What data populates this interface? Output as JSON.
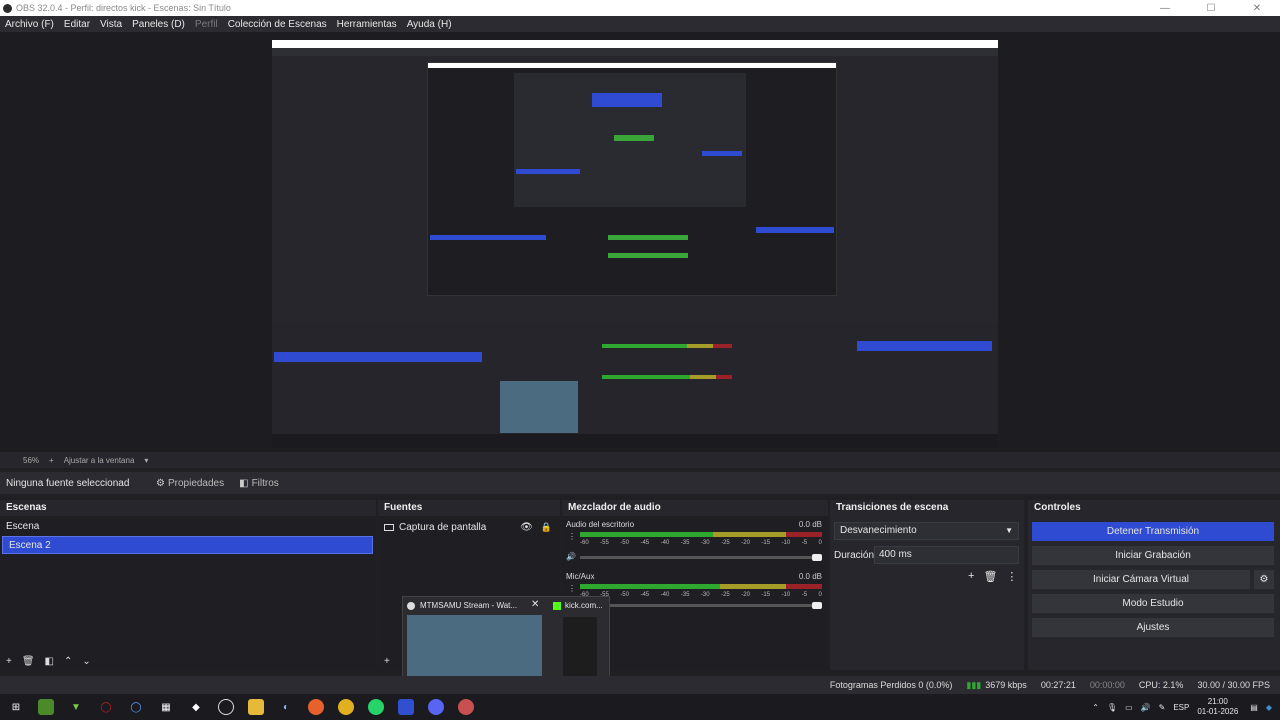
{
  "window": {
    "title": "OBS 32.0.4 - Perfil: directos kick - Escenas: Sin Título"
  },
  "menu": [
    "Archivo (F)",
    "Editar",
    "Vista",
    "Paneles (D)",
    "Perfil",
    "Colección de Escenas",
    "Herramientas",
    "Ayuda (H)"
  ],
  "zoom": {
    "value": "56%",
    "fit_label": "Ajustar a la ventana"
  },
  "context": {
    "no_source": "Ninguna fuente seleccionad",
    "properties": "Propiedades",
    "filters": "Filtros"
  },
  "scenes": {
    "title": "Escenas",
    "items": [
      "Escena",
      "Escena 2"
    ],
    "selected": 1
  },
  "sources": {
    "title": "Fuentes",
    "items": [
      "Captura de pantalla"
    ]
  },
  "mixer": {
    "title": "Mezclador de audio",
    "channels": [
      {
        "name": "Audio del escritorio",
        "db": "0.0 dB",
        "level": 0.55
      },
      {
        "name": "Mic/Aux",
        "db": "0.0 dB",
        "level": 0.58
      }
    ],
    "scale": [
      "-60",
      "-55",
      "-50",
      "-45",
      "-40",
      "-35",
      "-30",
      "-25",
      "-20",
      "-15",
      "-10",
      "-5",
      "0"
    ]
  },
  "transitions": {
    "title": "Transiciones de escena",
    "selected": "Desvanecimiento",
    "duration_label": "Duración",
    "duration_value": "400 ms"
  },
  "controls": {
    "title": "Controles",
    "stop_stream": "Detener Transmisión",
    "start_record": "Iniciar Grabación",
    "virtual_cam": "Iniciar Cámara Virtual",
    "studio_mode": "Modo Estudio",
    "settings": "Ajustes"
  },
  "thumbnail": {
    "tab1": "MTMSAMU Stream - Wat...",
    "tab2": "kick.com..."
  },
  "status": {
    "dropped": "Fotogramas Perdidos 0 (0.0%)",
    "bitrate": "3679 kbps",
    "stream_time": "00:27:21",
    "rec_time": "00:00:00",
    "cpu": "CPU: 2.1%",
    "fps": "30.00 / 30.00 FPS"
  },
  "taskbar": {
    "lang": "ESP",
    "time": "21:00",
    "date": "01-01-2026"
  },
  "colors": {
    "accent": "#2f4bd1",
    "meter_green": "#2fa82f",
    "meter_yellow": "#a59d28",
    "meter_red": "#9b2228"
  }
}
